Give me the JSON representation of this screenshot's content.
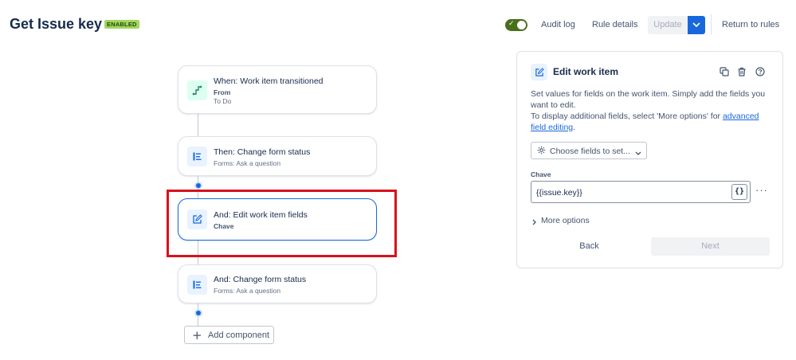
{
  "header": {
    "title": "Get Issue key",
    "status_badge": "ENABLED",
    "toggle_enabled": true,
    "audit_log": "Audit log",
    "rule_details": "Rule details",
    "update": "Update",
    "return_to_rules": "Return to rules"
  },
  "flow": {
    "trigger": {
      "title": "When: Work item transitioned",
      "sub_label": "From",
      "sub_value": "To Do",
      "icon": "transition-icon"
    },
    "action1": {
      "title": "Then: Change form status",
      "subtitle": "Forms: Ask a question",
      "icon": "form-icon"
    },
    "action2": {
      "title": "And: Edit work item fields",
      "subtitle": "Chave",
      "icon": "edit-icon"
    },
    "action3": {
      "title": "And: Change form status",
      "subtitle": "Forms: Ask a question",
      "icon": "form-icon"
    },
    "add_component": "Add component"
  },
  "panel": {
    "title": "Edit work item",
    "desc1": "Set values for fields on the work item. Simply add the fields you want to edit.",
    "desc2_prefix": "To display additional fields, select 'More options' for ",
    "desc2_link": "advanced field editing",
    "desc2_suffix": ".",
    "choose_fields": "Choose fields to set...",
    "field_label": "Chave",
    "field_value": "{{issue.key}}",
    "smart_value_glyph": "{}",
    "more_options": "More options",
    "back": "Back",
    "next": "Next"
  },
  "colors": {
    "accent": "#1868db",
    "highlight": "#d9101c",
    "badge_bg": "#a3d65c",
    "toggle_on": "#4a6f1c"
  }
}
